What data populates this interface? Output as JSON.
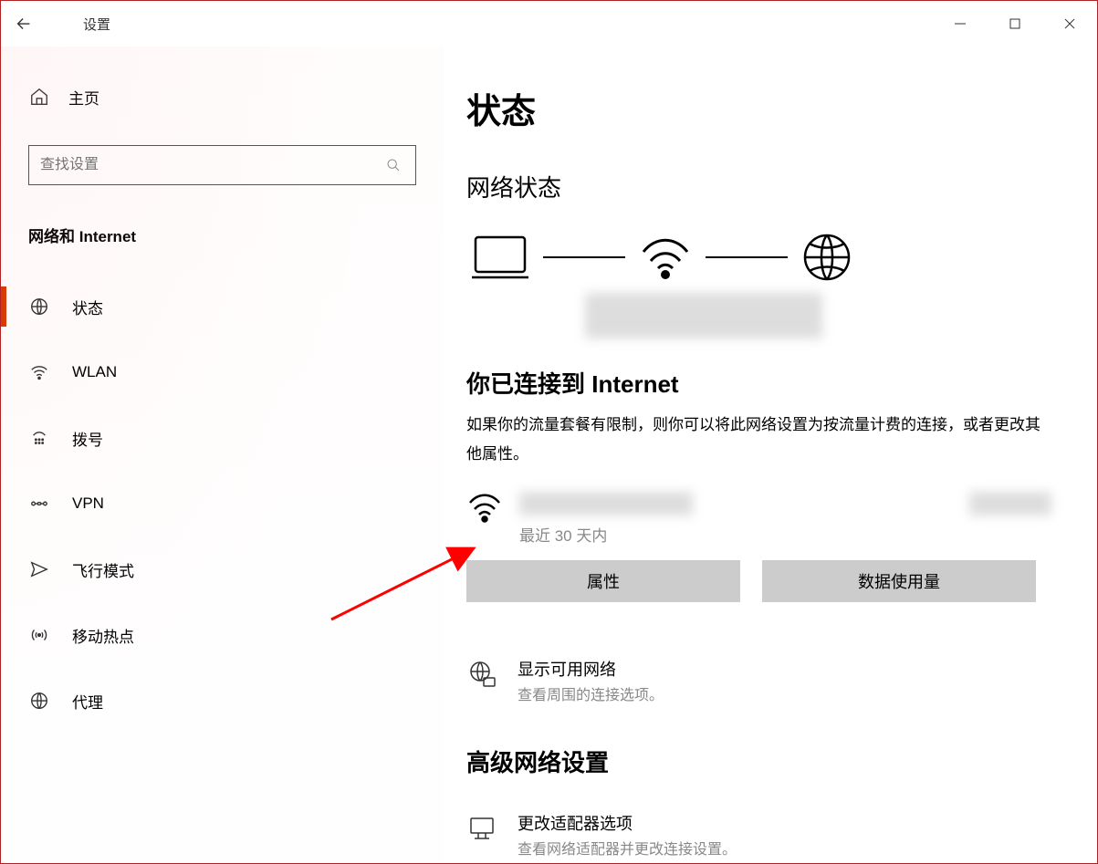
{
  "window": {
    "appTitle": "设置"
  },
  "sidebar": {
    "homeLabel": "主页",
    "searchPlaceholder": "查找设置",
    "categoryTitle": "网络和 Internet",
    "items": [
      {
        "label": "状态"
      },
      {
        "label": "WLAN"
      },
      {
        "label": "拨号"
      },
      {
        "label": "VPN"
      },
      {
        "label": "飞行模式"
      },
      {
        "label": "移动热点"
      },
      {
        "label": "代理"
      }
    ]
  },
  "main": {
    "pageTitle": "状态",
    "networkStatusTitle": "网络状态",
    "connectedTitle": "你已连接到 Internet",
    "connectedDesc": "如果你的流量套餐有限制，则你可以将此网络设置为按流量计费的连接，或者更改其他属性。",
    "recentText": "最近 30 天内",
    "propertiesBtn": "属性",
    "dataUsageBtn": "数据使用量",
    "showNetworks": {
      "title": "显示可用网络",
      "desc": "查看周围的连接选项。"
    },
    "advancedTitle": "高级网络设置",
    "adapterOptions": {
      "title": "更改适配器选项",
      "desc": "查看网络适配器并更改连接设置。"
    }
  },
  "annotation": {
    "color": "#ff0000"
  }
}
